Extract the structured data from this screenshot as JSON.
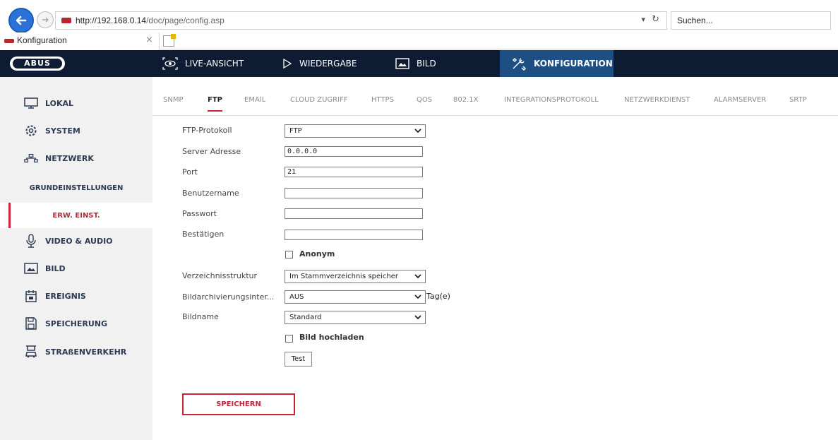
{
  "browser": {
    "url_host": "http://192.168.0.14",
    "url_path": "/doc/page/config.asp",
    "search_placeholder": "Suchen...",
    "tab_title": "Konfiguration"
  },
  "header": {
    "logo": "ABUS",
    "nav": [
      {
        "label": "LIVE-ANSICHT",
        "icon": "eye-icon"
      },
      {
        "label": "WIEDERGABE",
        "icon": "play-icon"
      },
      {
        "label": "BILD",
        "icon": "image-icon"
      },
      {
        "label": "KONFIGURATION",
        "icon": "tools-icon",
        "active": true
      }
    ],
    "active_color": "#1e4f84",
    "bg_color": "#0d1b33"
  },
  "sidebar": {
    "items": [
      {
        "label": "LOKAL",
        "icon": "monitor-icon"
      },
      {
        "label": "SYSTEM",
        "icon": "gear-icon"
      },
      {
        "label": "NETZWERK",
        "icon": "network-icon"
      },
      {
        "label": "GRUNDEINSTELLUNGEN",
        "sub": true
      },
      {
        "label": "ERW. EINST.",
        "sub": true,
        "active": true
      },
      {
        "label": "VIDEO & AUDIO",
        "icon": "microphone-icon"
      },
      {
        "label": "BILD",
        "icon": "image-icon"
      },
      {
        "label": "EREIGNIS",
        "icon": "calendar-icon"
      },
      {
        "label": "SPEICHERUNG",
        "icon": "storage-icon"
      },
      {
        "label": "STRAßENVERKEHR",
        "icon": "traffic-icon"
      }
    ],
    "accent_color": "#c8243a"
  },
  "tabs": [
    "SNMP",
    "FTP",
    "EMAIL",
    "CLOUD ZUGRIFF",
    "HTTPS",
    "QOS",
    "802.1X",
    "INTEGRATIONSPROTOKOLL",
    "NETZWERKDIENST",
    "ALARMSERVER",
    "SRTP"
  ],
  "active_tab": "FTP",
  "form": {
    "protocol_label": "FTP-Protokoll",
    "protocol_value": "FTP",
    "server_label": "Server Adresse",
    "server_value": "0.0.0.0",
    "port_label": "Port",
    "port_value": "21",
    "username_label": "Benutzername",
    "username_value": "",
    "password_label": "Passwort",
    "password_value": "",
    "confirm_label": "Bestätigen",
    "confirm_value": "",
    "anonym_label": "Anonym",
    "dir_label": "Verzeichnisstruktur",
    "dir_value": "Im Stammverzeichnis speicher",
    "archive_label": "Bildarchivierungsinter...",
    "archive_value": "AUS",
    "archive_unit": "Tag(e)",
    "imagename_label": "Bildname",
    "imagename_value": "Standard",
    "upload_label": "Bild hochladen",
    "test_label": "Test",
    "save_label": "SPEICHERN"
  }
}
